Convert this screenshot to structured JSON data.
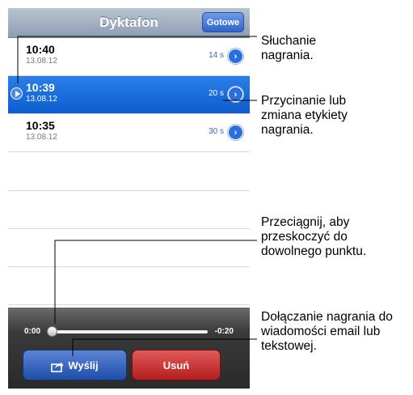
{
  "navbar": {
    "title": "Dyktafon",
    "done_label": "Gotowe"
  },
  "recordings": [
    {
      "time": "10:40",
      "date": "13.08.12",
      "duration": "14 s",
      "selected": false
    },
    {
      "time": "10:39",
      "date": "13.08.12",
      "duration": "20 s",
      "selected": true
    },
    {
      "time": "10:35",
      "date": "13.08.12",
      "duration": "30 s",
      "selected": false
    }
  ],
  "player": {
    "elapsed": "0:00",
    "remaining": "-0:20",
    "send_label": "Wyślij",
    "delete_label": "Usuń"
  },
  "callouts": {
    "listen": "Słuchanie nagrania.",
    "trim": "Przycinanie lub zmiana etykiety nagrania.",
    "scrub": "Przeciągnij, aby przeskoczyć do dowolnego punktu.",
    "attach": "Dołączanie nagrania do wiadomości email lub tekstowej."
  }
}
